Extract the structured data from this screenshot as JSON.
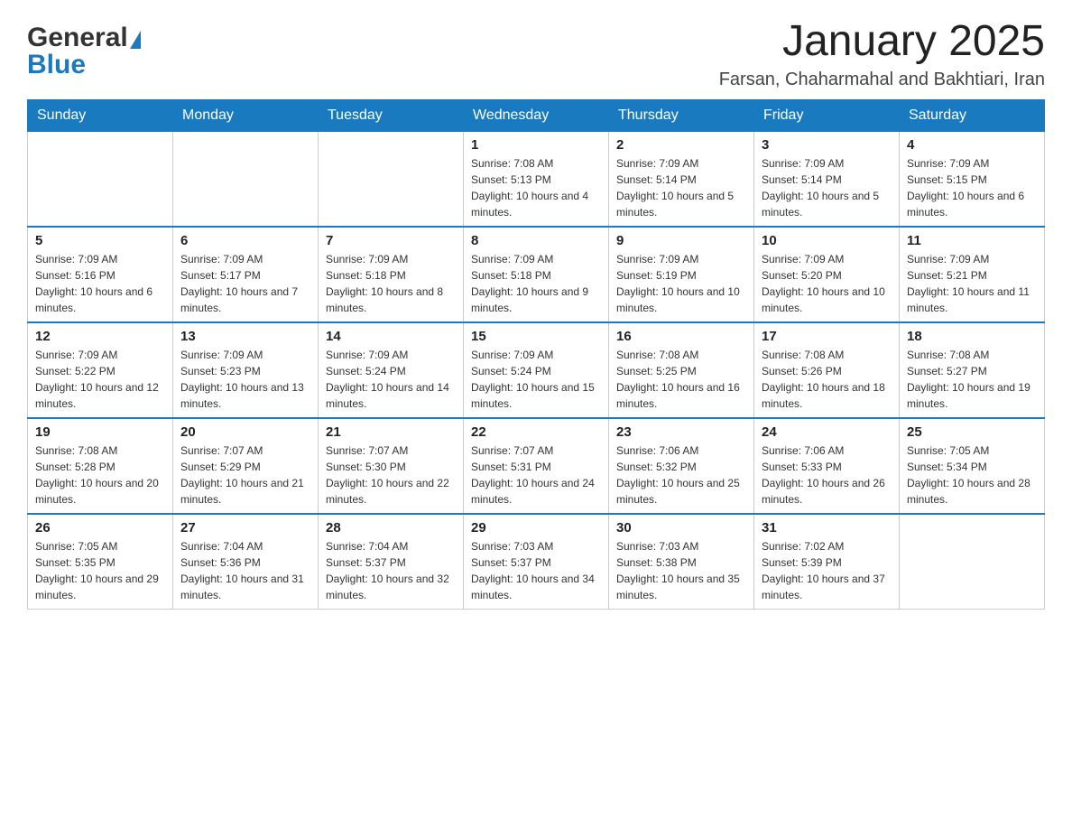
{
  "header": {
    "logo_general": "General",
    "logo_blue": "Blue",
    "month_title": "January 2025",
    "location": "Farsan, Chaharmahal and Bakhtiari, Iran"
  },
  "days_of_week": [
    "Sunday",
    "Monday",
    "Tuesday",
    "Wednesday",
    "Thursday",
    "Friday",
    "Saturday"
  ],
  "weeks": [
    {
      "days": [
        {
          "num": "",
          "info": ""
        },
        {
          "num": "",
          "info": ""
        },
        {
          "num": "",
          "info": ""
        },
        {
          "num": "1",
          "info": "Sunrise: 7:08 AM\nSunset: 5:13 PM\nDaylight: 10 hours and 4 minutes."
        },
        {
          "num": "2",
          "info": "Sunrise: 7:09 AM\nSunset: 5:14 PM\nDaylight: 10 hours and 5 minutes."
        },
        {
          "num": "3",
          "info": "Sunrise: 7:09 AM\nSunset: 5:14 PM\nDaylight: 10 hours and 5 minutes."
        },
        {
          "num": "4",
          "info": "Sunrise: 7:09 AM\nSunset: 5:15 PM\nDaylight: 10 hours and 6 minutes."
        }
      ]
    },
    {
      "days": [
        {
          "num": "5",
          "info": "Sunrise: 7:09 AM\nSunset: 5:16 PM\nDaylight: 10 hours and 6 minutes."
        },
        {
          "num": "6",
          "info": "Sunrise: 7:09 AM\nSunset: 5:17 PM\nDaylight: 10 hours and 7 minutes."
        },
        {
          "num": "7",
          "info": "Sunrise: 7:09 AM\nSunset: 5:18 PM\nDaylight: 10 hours and 8 minutes."
        },
        {
          "num": "8",
          "info": "Sunrise: 7:09 AM\nSunset: 5:18 PM\nDaylight: 10 hours and 9 minutes."
        },
        {
          "num": "9",
          "info": "Sunrise: 7:09 AM\nSunset: 5:19 PM\nDaylight: 10 hours and 10 minutes."
        },
        {
          "num": "10",
          "info": "Sunrise: 7:09 AM\nSunset: 5:20 PM\nDaylight: 10 hours and 10 minutes."
        },
        {
          "num": "11",
          "info": "Sunrise: 7:09 AM\nSunset: 5:21 PM\nDaylight: 10 hours and 11 minutes."
        }
      ]
    },
    {
      "days": [
        {
          "num": "12",
          "info": "Sunrise: 7:09 AM\nSunset: 5:22 PM\nDaylight: 10 hours and 12 minutes."
        },
        {
          "num": "13",
          "info": "Sunrise: 7:09 AM\nSunset: 5:23 PM\nDaylight: 10 hours and 13 minutes."
        },
        {
          "num": "14",
          "info": "Sunrise: 7:09 AM\nSunset: 5:24 PM\nDaylight: 10 hours and 14 minutes."
        },
        {
          "num": "15",
          "info": "Sunrise: 7:09 AM\nSunset: 5:24 PM\nDaylight: 10 hours and 15 minutes."
        },
        {
          "num": "16",
          "info": "Sunrise: 7:08 AM\nSunset: 5:25 PM\nDaylight: 10 hours and 16 minutes."
        },
        {
          "num": "17",
          "info": "Sunrise: 7:08 AM\nSunset: 5:26 PM\nDaylight: 10 hours and 18 minutes."
        },
        {
          "num": "18",
          "info": "Sunrise: 7:08 AM\nSunset: 5:27 PM\nDaylight: 10 hours and 19 minutes."
        }
      ]
    },
    {
      "days": [
        {
          "num": "19",
          "info": "Sunrise: 7:08 AM\nSunset: 5:28 PM\nDaylight: 10 hours and 20 minutes."
        },
        {
          "num": "20",
          "info": "Sunrise: 7:07 AM\nSunset: 5:29 PM\nDaylight: 10 hours and 21 minutes."
        },
        {
          "num": "21",
          "info": "Sunrise: 7:07 AM\nSunset: 5:30 PM\nDaylight: 10 hours and 22 minutes."
        },
        {
          "num": "22",
          "info": "Sunrise: 7:07 AM\nSunset: 5:31 PM\nDaylight: 10 hours and 24 minutes."
        },
        {
          "num": "23",
          "info": "Sunrise: 7:06 AM\nSunset: 5:32 PM\nDaylight: 10 hours and 25 minutes."
        },
        {
          "num": "24",
          "info": "Sunrise: 7:06 AM\nSunset: 5:33 PM\nDaylight: 10 hours and 26 minutes."
        },
        {
          "num": "25",
          "info": "Sunrise: 7:05 AM\nSunset: 5:34 PM\nDaylight: 10 hours and 28 minutes."
        }
      ]
    },
    {
      "days": [
        {
          "num": "26",
          "info": "Sunrise: 7:05 AM\nSunset: 5:35 PM\nDaylight: 10 hours and 29 minutes."
        },
        {
          "num": "27",
          "info": "Sunrise: 7:04 AM\nSunset: 5:36 PM\nDaylight: 10 hours and 31 minutes."
        },
        {
          "num": "28",
          "info": "Sunrise: 7:04 AM\nSunset: 5:37 PM\nDaylight: 10 hours and 32 minutes."
        },
        {
          "num": "29",
          "info": "Sunrise: 7:03 AM\nSunset: 5:37 PM\nDaylight: 10 hours and 34 minutes."
        },
        {
          "num": "30",
          "info": "Sunrise: 7:03 AM\nSunset: 5:38 PM\nDaylight: 10 hours and 35 minutes."
        },
        {
          "num": "31",
          "info": "Sunrise: 7:02 AM\nSunset: 5:39 PM\nDaylight: 10 hours and 37 minutes."
        },
        {
          "num": "",
          "info": ""
        }
      ]
    }
  ]
}
